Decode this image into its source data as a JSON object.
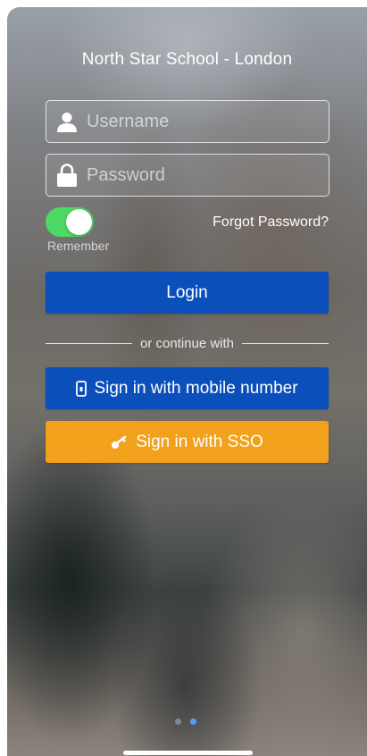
{
  "app": {
    "title": "North Star School - London"
  },
  "login_form": {
    "username": {
      "value": "",
      "placeholder": "Username",
      "icon": "user-icon"
    },
    "password": {
      "value": "",
      "placeholder": "Password",
      "icon": "lock-icon"
    },
    "remember": {
      "label": "Remember",
      "on": true
    },
    "forgot_password_label": "Forgot Password?",
    "login_label": "Login"
  },
  "alt_login": {
    "divider_text": "or continue with",
    "mobile": {
      "label": "Sign in with mobile number",
      "icon": "mobile-phone-icon",
      "color": "#0b4fbb"
    },
    "sso": {
      "label": "Sign in with SSO",
      "icon": "key-icon",
      "color": "#f2a11c"
    }
  },
  "colors": {
    "primary": "#0b4fbb",
    "sso": "#f2a11c",
    "toggle_on": "#4cd964",
    "page_indicator_active": "#4aa3f5"
  },
  "pagination": {
    "pages": 2,
    "current": 2
  }
}
